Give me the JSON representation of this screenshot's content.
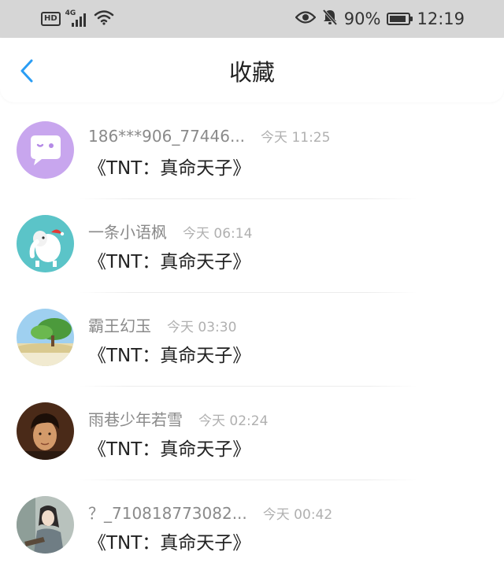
{
  "status_bar": {
    "hd": "HD",
    "network": "4G",
    "battery": "90%",
    "battery_level": 0.9,
    "time": "12:19",
    "icons": [
      "hd-icon",
      "signal-icon",
      "wifi-icon",
      "eye-icon",
      "bell-off-icon",
      "battery-icon"
    ]
  },
  "header": {
    "title": "收藏",
    "back_icon": "chevron-left-icon"
  },
  "colors": {
    "status_bar_bg": "#d6d6d6",
    "accent": "#2a9df4",
    "username": "#8a8a8a",
    "time": "#b0b0b0"
  },
  "favorites": [
    {
      "username": "186***906_77446...",
      "time": "今天 11:25",
      "content": "《TNT：真命天子》",
      "avatar": "chat-bubble-avatar"
    },
    {
      "username": "一条小语枫",
      "time": "今天 06:14",
      "content": "《TNT：真命天子》",
      "avatar": "elephant-avatar"
    },
    {
      "username": "霸王幻玉",
      "time": "今天 03:30",
      "content": "《TNT：真命天子》",
      "avatar": "tree-landscape-avatar"
    },
    {
      "username": "雨巷少年若雪",
      "time": "今天 02:24",
      "content": "《TNT：真命天子》",
      "avatar": "portrait-man-avatar"
    },
    {
      "username": "？_710818773082...",
      "time": "今天 00:42",
      "content": "《TNT：真命天子》",
      "avatar": "illustrated-woman-avatar"
    }
  ]
}
